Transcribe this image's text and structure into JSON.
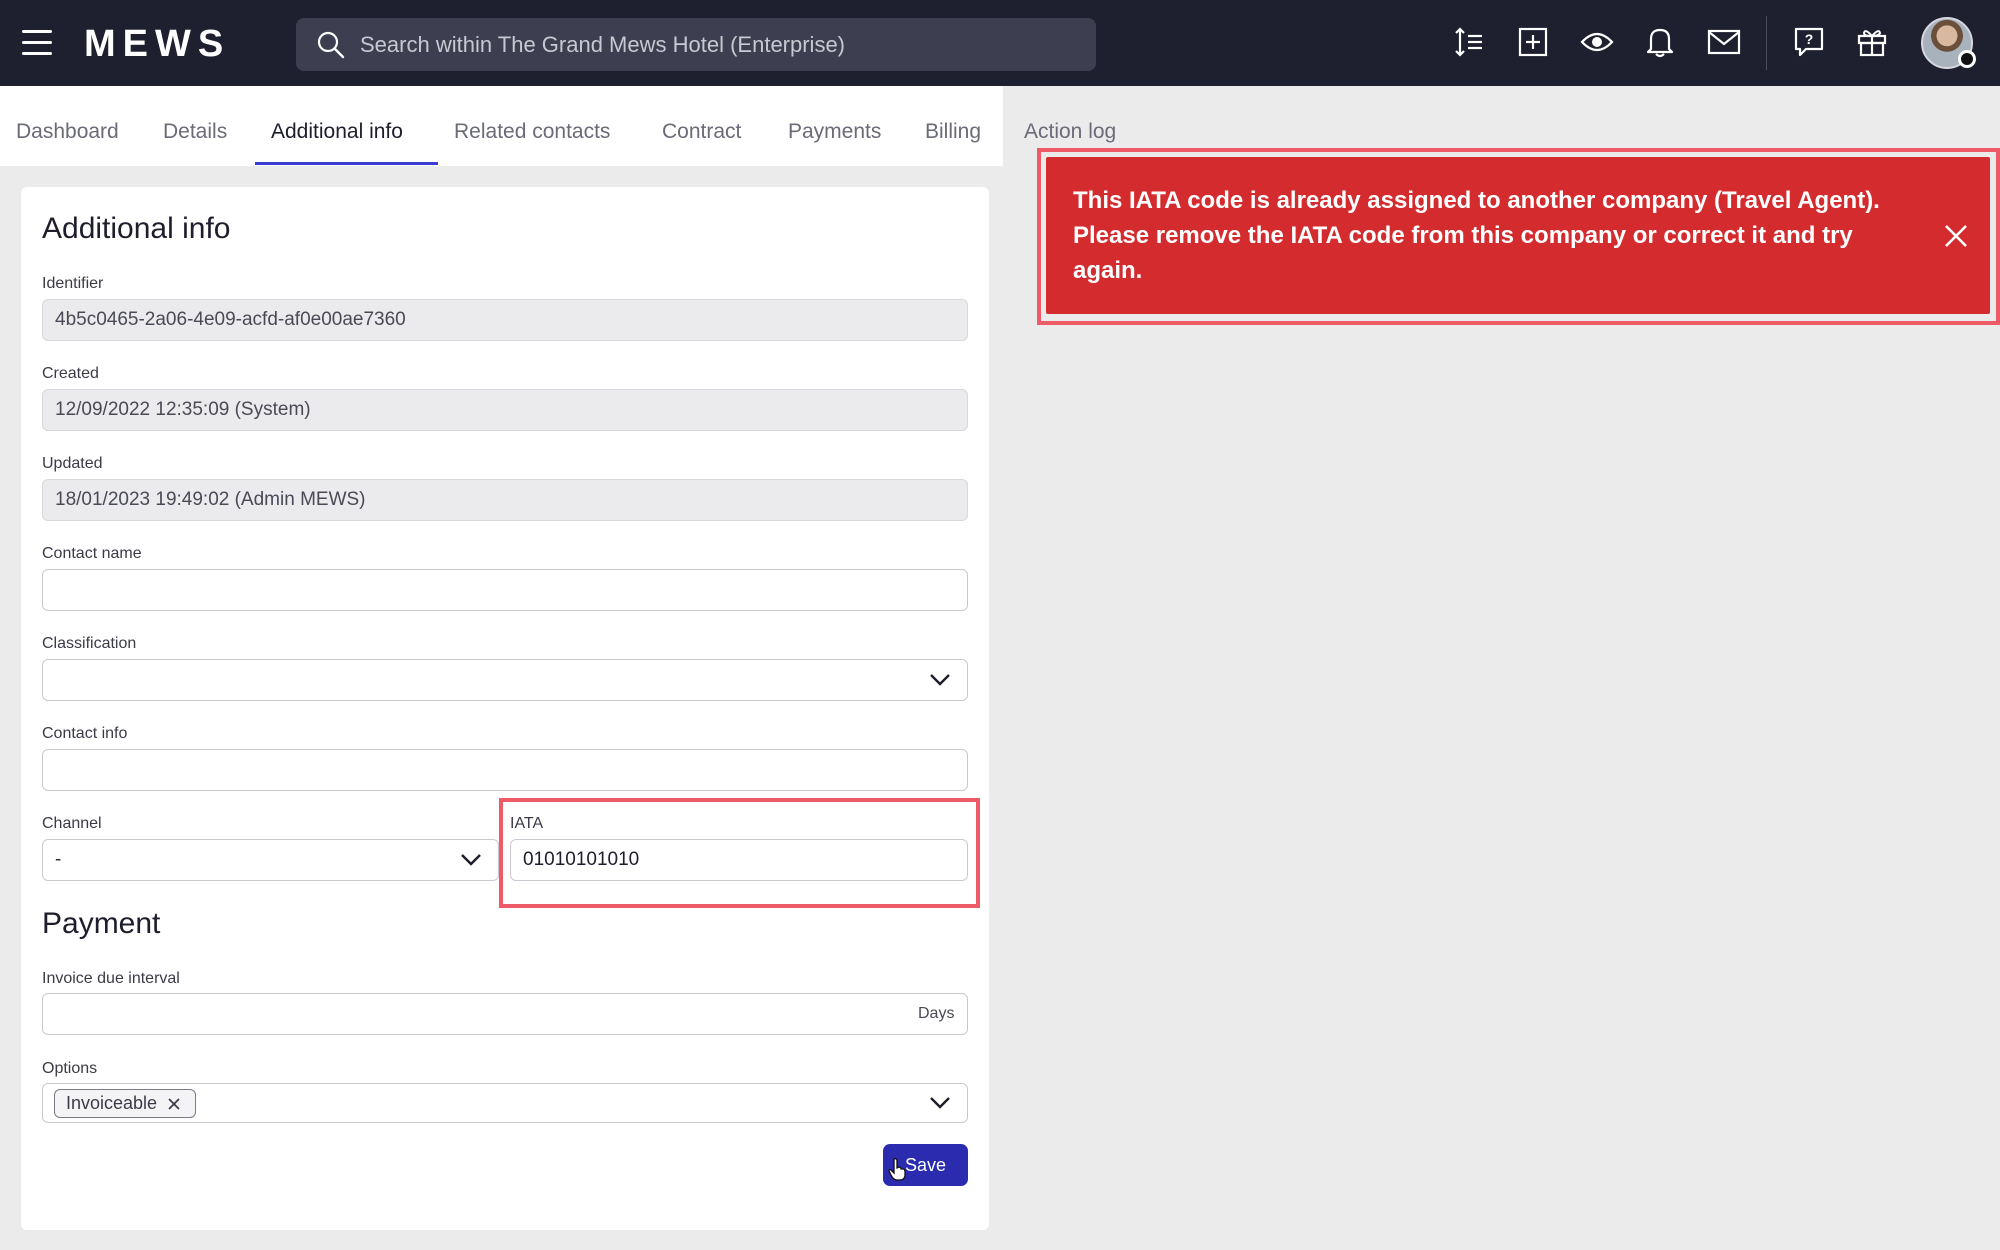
{
  "header": {
    "logo": "MEWS",
    "search_placeholder": "Search within The Grand Mews Hotel (Enterprise)"
  },
  "icons": {
    "menu": "hamburger-menu-icon",
    "search": "search-icon",
    "toolbar": [
      "sort-lines-icon",
      "add-square-icon",
      "eye-icon",
      "bell-icon",
      "mail-icon",
      "help-chat-icon",
      "gift-icon"
    ]
  },
  "tabs": [
    {
      "label": "Dashboard",
      "active": false
    },
    {
      "label": "Details",
      "active": false
    },
    {
      "label": "Additional info",
      "active": true
    },
    {
      "label": "Related contacts",
      "active": false
    },
    {
      "label": "Contract",
      "active": false
    },
    {
      "label": "Payments",
      "active": false
    },
    {
      "label": "Billing",
      "active": false
    },
    {
      "label": "Action log",
      "active": false
    }
  ],
  "form": {
    "title": "Additional info",
    "identifier": {
      "label": "Identifier",
      "value": "4b5c0465-2a06-4e09-acfd-af0e00ae7360"
    },
    "created": {
      "label": "Created",
      "value": "12/09/2022 12:35:09 (System)"
    },
    "updated": {
      "label": "Updated",
      "value": "18/01/2023 19:49:02 (Admin MEWS)"
    },
    "contact_name": {
      "label": "Contact name",
      "value": ""
    },
    "classification": {
      "label": "Classification",
      "value": ""
    },
    "contact_info": {
      "label": "Contact info",
      "value": ""
    },
    "channel": {
      "label": "Channel",
      "value": "-"
    },
    "iata": {
      "label": "IATA",
      "value": "01010101010"
    },
    "payment_title": "Payment",
    "invoice_due": {
      "label": "Invoice due interval",
      "value": "",
      "suffix": "Days"
    },
    "options": {
      "label": "Options",
      "chips": [
        "Invoiceable"
      ]
    },
    "save_label": "Save"
  },
  "alert": {
    "message": "This IATA code is already assigned to another company (Travel Agent). Please remove the IATA code from this company or correct it and try again.",
    "color": "#d42c2e"
  },
  "colors": {
    "topbar": "#1e1f2f",
    "accent": "#3a3bd0",
    "save_button": "#2b2bb0",
    "highlight": "#ee5a66"
  }
}
